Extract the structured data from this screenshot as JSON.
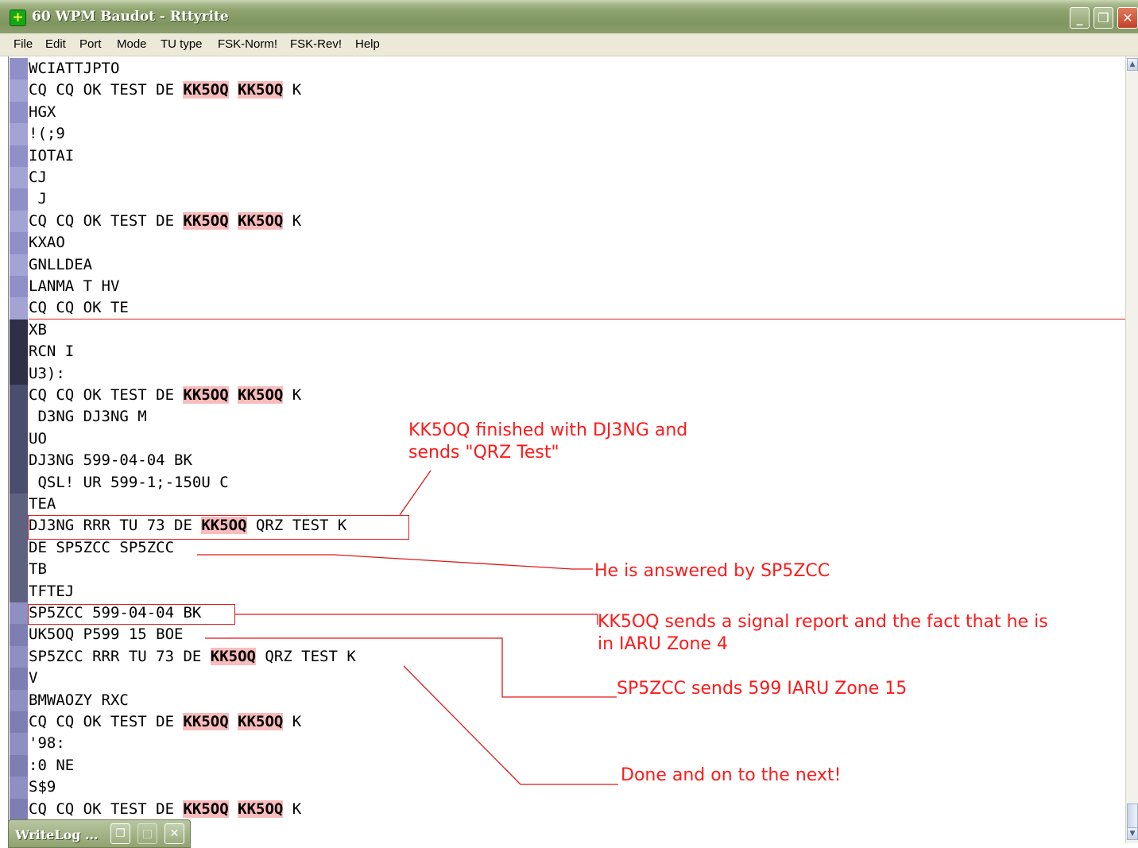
{
  "window": {
    "title": "60 WPM Baudot - Rttyrite",
    "minimize_glyph": "_",
    "restore_glyph": "❐",
    "close_glyph": "✕"
  },
  "menu": [
    "File",
    "Edit",
    "Port",
    "Mode",
    "TU type",
    "FSK-Norm!",
    "FSK-Rev!",
    "Help"
  ],
  "lines": [
    "WCIATTJPTO",
    "CQ CQ OK TEST DE |KK5OQ| |KK5OQ| K",
    "HGX",
    "!(;9",
    "IOTAI",
    "CJ",
    " J",
    "CQ CQ OK TEST DE |KK5OQ| |KK5OQ| K",
    "KXAO",
    "GNLLDEA",
    "LANMA T HV",
    "CQ CQ OK TE",
    "XB",
    "RCN I",
    "U3):",
    "CQ CQ OK TEST DE |KK5OQ| |KK5OQ| K",
    " D3NG DJ3NG M",
    "UO",
    "DJ3NG 599-04-04 BK",
    " QSL! UR 599-1;-150U C",
    "TEA",
    "DJ3NG RRR TU 73 DE |KK5OQ| QRZ TEST K",
    "DE SP5ZCC SP5ZCC",
    "TB",
    "TFTEJ",
    "SP5ZCC 599-04-04 BK",
    "UK5OQ P599 15 BOE",
    "SP5ZCC RRR TU 73 DE |KK5OQ| QRZ TEST K",
    "V",
    "BMWAOZY RXC",
    "CQ CQ OK TEST DE |KK5OQ| |KK5OQ| K",
    "'98:",
    ":0 NE",
    "S$9",
    "CQ CQ OK TEST DE |KK5OQ| |KK5OQ| K"
  ],
  "annotations": {
    "a1_line1": "KK5OQ finished with DJ3NG and",
    "a1_line2": "sends \"QRZ Test\"",
    "a2": "He is answered by SP5ZCC",
    "a3_line1": "KK5OQ sends a signal report and the fact that he is",
    "a3_line2": "in IARU Zone 4",
    "a4": "SP5ZCC sends 599 IARU Zone 15",
    "a5": "Done and on to the next!"
  },
  "taskbar": {
    "title": "WriteLog ...",
    "restore_glyph": "❐",
    "max_glyph": "□",
    "close_glyph": "✕"
  },
  "colors": {
    "annotation": "#ff1a1a",
    "callsign_highlight": "#f8bcbc"
  }
}
